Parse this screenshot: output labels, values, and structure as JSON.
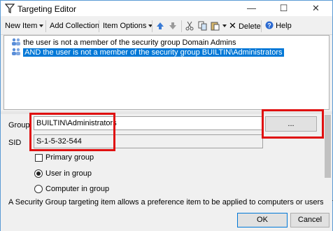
{
  "window": {
    "title": "Targeting Editor"
  },
  "toolbar": {
    "new_item": "New Item",
    "add_collection": "Add Collection",
    "item_options": "Item Options",
    "delete": "Delete",
    "help": "Help"
  },
  "tree": {
    "items": [
      {
        "label": "the user is not a member of the security group Domain Admins",
        "selected": false
      },
      {
        "label": "AND the user is not a member of the security group BUILTIN\\Administrators",
        "selected": true
      }
    ]
  },
  "form": {
    "group_label": "Group",
    "group_value": "BUILTIN\\Administrators",
    "browse_label": "...",
    "sid_label": "SID",
    "sid_value": "S-1-5-32-544",
    "primary_group": "Primary group",
    "user_in_group": "User in group",
    "computer_in_group": "Computer in group",
    "selected_option": "User in group",
    "description": "A Security Group targeting item allows a preference item to be applied to computers or users only if"
  },
  "buttons": {
    "ok": "OK",
    "cancel": "Cancel"
  },
  "colors": {
    "highlight": "#0078d7",
    "annotation_red": "#e01010"
  }
}
